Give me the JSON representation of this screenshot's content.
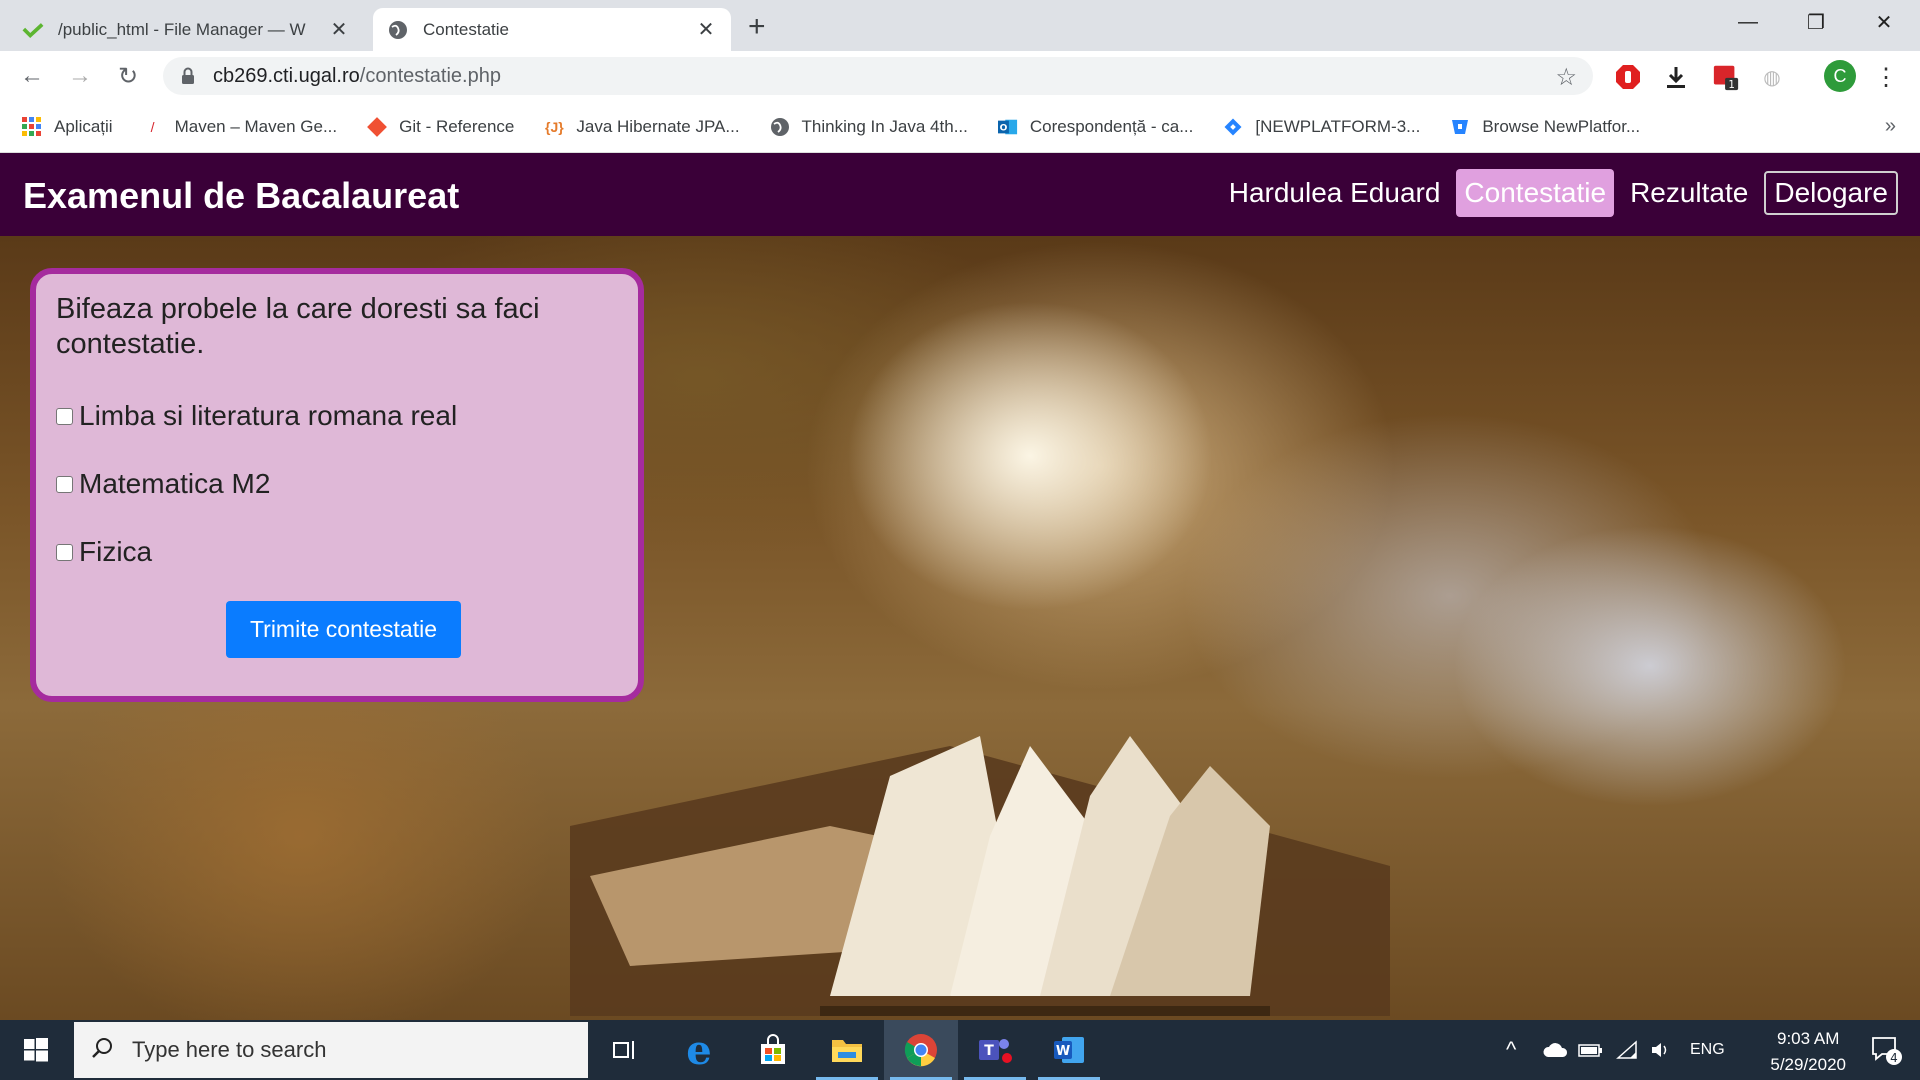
{
  "browser": {
    "tabs": [
      {
        "title": "/public_html - File Manager — W",
        "active": false
      },
      {
        "title": "Contestatie",
        "active": true
      }
    ],
    "url_host": "cb269.cti.ugal.ro",
    "url_path": "/contestatie.php",
    "bookmarks": [
      {
        "label": "Aplicații",
        "icon": "apps-grid-icon"
      },
      {
        "label": "Maven – Maven Ge...",
        "icon": "maven-icon"
      },
      {
        "label": "Git - Reference",
        "icon": "git-icon"
      },
      {
        "label": "Java Hibernate JPA...",
        "icon": "java-icon"
      },
      {
        "label": "Thinking In Java 4th...",
        "icon": "globe-icon"
      },
      {
        "label": "Corespondență - ca...",
        "icon": "outlook-icon"
      },
      {
        "label": "[NEWPLATFORM-3...",
        "icon": "jira-icon"
      },
      {
        "label": "Browse NewPlatfor...",
        "icon": "bitbucket-icon"
      }
    ],
    "profile_initial": "C"
  },
  "site": {
    "title": "Examenul de Bacalaureat",
    "nav": {
      "user": "Hardulea Eduard",
      "contest": "Contestatie",
      "results": "Rezultate",
      "logout": "Delogare"
    }
  },
  "form": {
    "heading": "Bifeaza probele la care doresti sa faci contestatie.",
    "options": [
      {
        "label": "Limba si literatura romana real",
        "checked": false
      },
      {
        "label": "Matematica M2",
        "checked": false
      },
      {
        "label": "Fizica",
        "checked": false
      }
    ],
    "submit": "Trimite contestatie"
  },
  "taskbar": {
    "search_placeholder": "Type here to search",
    "language": "ENG",
    "time": "9:03 AM",
    "date": "5/29/2020",
    "notifications": "4"
  },
  "colors": {
    "header_bg": "#3a0038",
    "active_nav": "#e0a0df",
    "card_bg": "#dfb8d7",
    "card_border": "#a52b9e",
    "button": "#0a7cff"
  }
}
